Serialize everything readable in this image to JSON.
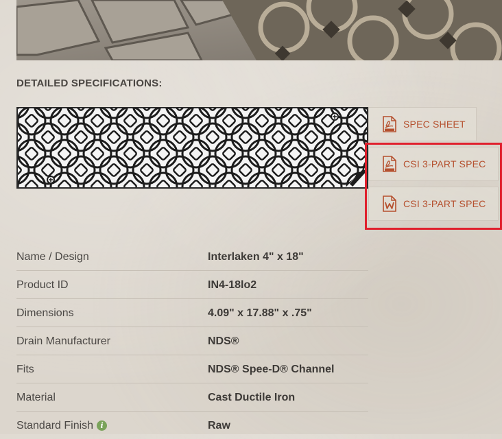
{
  "section_title": "DETAILED SPECIFICATIONS:",
  "downloads": [
    {
      "label": "SPEC SHEET",
      "icon": "pdf-file-icon"
    },
    {
      "label": "CSI 3-PART SPEC",
      "icon": "pdf-file-icon"
    },
    {
      "label": "CSI 3-PART SPEC",
      "icon": "word-file-icon"
    }
  ],
  "specs": [
    {
      "key": "Name / Design",
      "value": "Interlaken 4\" x 18\""
    },
    {
      "key": "Product ID",
      "value": "IN4-18lo2"
    },
    {
      "key": "Dimensions",
      "value": "4.09\" x 17.88\" x .75\""
    },
    {
      "key": "Drain Manufacturer",
      "value": "NDS®"
    },
    {
      "key": "Fits",
      "value": "NDS® Spee-D® Channel"
    },
    {
      "key": "Material",
      "value": "Cast Ductile Iron"
    },
    {
      "key": "Standard Finish",
      "value": "Raw"
    }
  ],
  "colors": {
    "link": "#b5502e",
    "highlight": "#e0202d",
    "info": "#7aa35a"
  }
}
